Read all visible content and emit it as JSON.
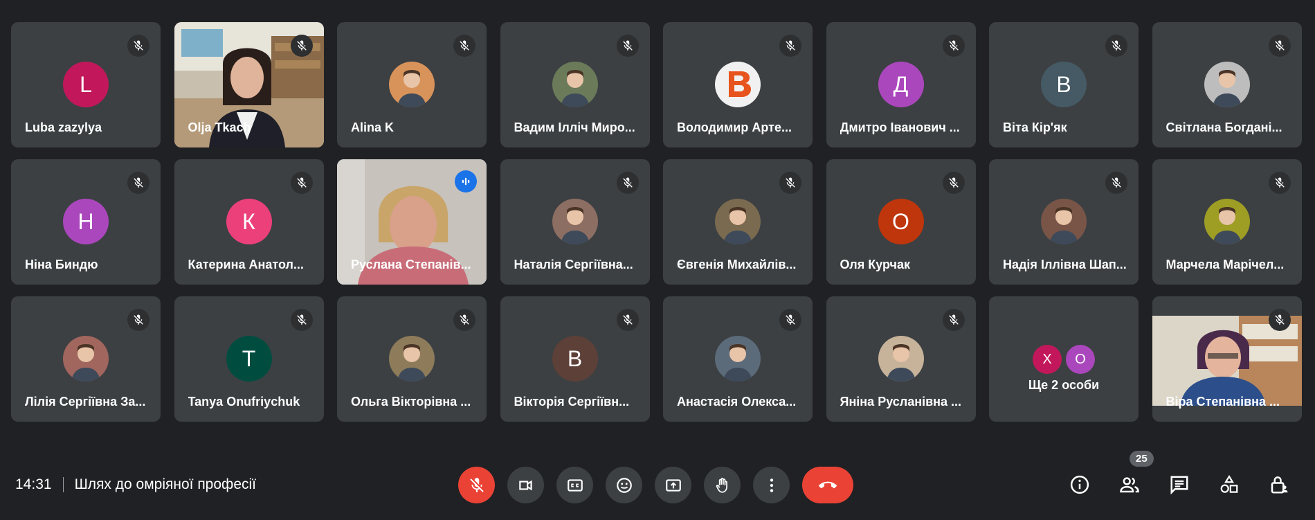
{
  "participants": [
    {
      "name": "Luba zazylya",
      "initial": "L",
      "color": "#c2185b",
      "kind": "initial"
    },
    {
      "name": "Olja Tkach",
      "kind": "video"
    },
    {
      "name": "Alina K",
      "kind": "photo",
      "color": "#d8935a"
    },
    {
      "name": "Вадим Ілліч Миро...",
      "kind": "photo",
      "color": "#6b7b5a"
    },
    {
      "name": "Володимир Арте...",
      "kind": "logo"
    },
    {
      "name": "Дмитро Іванович ...",
      "initial": "Д",
      "color": "#ab47bc",
      "kind": "initial"
    },
    {
      "name": "Віта Кір'як",
      "initial": "В",
      "color": "#455a64",
      "kind": "initial"
    },
    {
      "name": "Світлана Богдані...",
      "kind": "photo",
      "color": "#bdbdbd"
    },
    {
      "name": "Ніна Биндю",
      "initial": "Н",
      "color": "#ab47bc",
      "kind": "initial"
    },
    {
      "name": "Катерина Анатол...",
      "initial": "К",
      "color": "#ec407a",
      "kind": "initial"
    },
    {
      "name": "Руслана Степанів...",
      "kind": "video-speaking"
    },
    {
      "name": "Наталія Сергіївна...",
      "kind": "photo",
      "color": "#8d6e63"
    },
    {
      "name": "Євгенія Михайлів...",
      "kind": "photo",
      "color": "#7a6a4f"
    },
    {
      "name": "Оля Курчак",
      "initial": "О",
      "color": "#bf360c",
      "kind": "initial"
    },
    {
      "name": "Надія Іллівна Шап...",
      "kind": "photo",
      "color": "#795548"
    },
    {
      "name": "Марчела Марічел...",
      "kind": "photo",
      "color": "#9e9d24"
    },
    {
      "name": "Лілія Сергіївна За...",
      "kind": "photo",
      "color": "#a1665e"
    },
    {
      "name": "Tanya Onufriychuk",
      "initial": "T",
      "color": "#004d40",
      "kind": "initial"
    },
    {
      "name": "Ольга Вікторівна ...",
      "kind": "photo",
      "color": "#8d7b5a"
    },
    {
      "name": "Вікторія Сергіївн...",
      "initial": "В",
      "color": "#5d4037",
      "kind": "initial"
    },
    {
      "name": "Анастасія Олекса...",
      "kind": "photo",
      "color": "#5c6b7a"
    },
    {
      "name": "Яніна Русланівна ...",
      "kind": "photo",
      "color": "#c7b39a"
    },
    {
      "name": "Ще 2 особи",
      "kind": "more",
      "minis": [
        {
          "initial": "Х",
          "color": "#c2185b"
        },
        {
          "initial": "О",
          "color": "#ab47bc"
        }
      ]
    },
    {
      "name": "Віра Степанівна ...",
      "kind": "video2"
    }
  ],
  "bottom": {
    "time": "14:31",
    "meeting_title": "Шлях до омріяної професії",
    "participant_count": "25"
  },
  "controls": [
    "mic-off",
    "camera",
    "captions",
    "emoji",
    "present",
    "raise-hand",
    "more-options",
    "end-call"
  ],
  "right_icons": [
    "info",
    "people",
    "chat",
    "activities",
    "host-controls"
  ]
}
